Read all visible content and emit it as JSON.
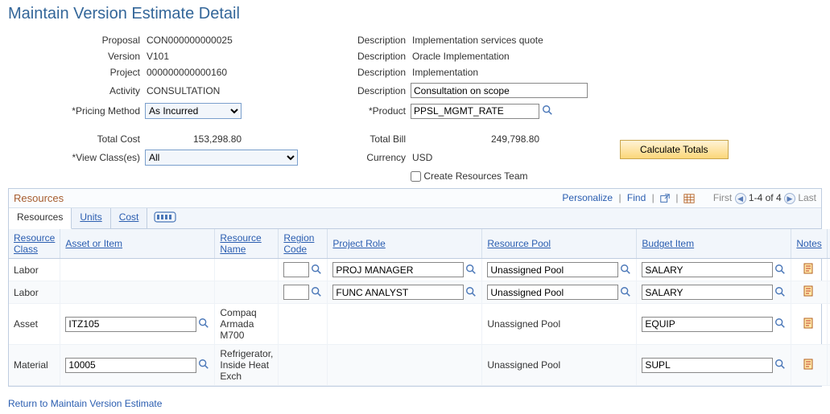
{
  "page_title": "Maintain Version Estimate Detail",
  "form": {
    "proposal": {
      "label": "Proposal",
      "value": "CON000000000025",
      "desc_label": "Description",
      "desc": "Implementation services quote"
    },
    "version": {
      "label": "Version",
      "value": "V101",
      "desc_label": "Description",
      "desc": "Oracle Implementation"
    },
    "project": {
      "label": "Project",
      "value": "000000000000160",
      "desc_label": "Description",
      "desc": "Implementation"
    },
    "activity": {
      "label": "Activity",
      "value": "CONSULTATION",
      "desc_label": "Description",
      "desc": "Consultation on scope"
    },
    "pricing_method": {
      "label": "*Pricing Method",
      "value": "As Incurred"
    },
    "product": {
      "label": "*Product",
      "value": "PPSL_MGMT_RATE"
    },
    "total_cost": {
      "label": "Total Cost",
      "value": "153,298.80"
    },
    "total_bill": {
      "label": "Total Bill",
      "value": "249,798.80"
    },
    "view_classes": {
      "label": "*View Class(es)",
      "value": "All"
    },
    "currency": {
      "label": "Currency",
      "value": "USD"
    },
    "create_team": {
      "label": "Create Resources Team"
    },
    "calc_button": "Calculate Totals"
  },
  "grid": {
    "title": "Resources",
    "links": {
      "personalize": "Personalize",
      "find": "Find"
    },
    "pager": {
      "first": "First",
      "range": "1-4 of 4",
      "last": "Last"
    },
    "tabs": {
      "resources": "Resources",
      "units": "Units",
      "cost": "Cost"
    },
    "headers": {
      "resource_class": "Resource Class",
      "asset_item": "Asset or Item",
      "resource_name": "Resource Name",
      "region_code": "Region Code",
      "project_role": "Project Role",
      "resource_pool": "Resource Pool",
      "budget_item": "Budget Item",
      "notes": "Notes"
    },
    "rows": [
      {
        "resource_class": "Labor",
        "asset_item": "",
        "resource_name": "",
        "region_code": "",
        "project_role": "PROJ MANAGER",
        "resource_pool": "Unassigned Pool",
        "budget_item": "SALARY"
      },
      {
        "resource_class": "Labor",
        "asset_item": "",
        "resource_name": "",
        "region_code": "",
        "project_role": "FUNC ANALYST",
        "resource_pool": "Unassigned Pool",
        "budget_item": "SALARY"
      },
      {
        "resource_class": "Asset",
        "asset_item": "ITZ105",
        "resource_name": "Compaq Armada M700",
        "region_code": "",
        "project_role": "",
        "resource_pool": "Unassigned Pool",
        "budget_item": "EQUIP"
      },
      {
        "resource_class": "Material",
        "asset_item": "10005",
        "resource_name": "Refrigerator, Inside Heat Exch",
        "region_code": "",
        "project_role": "",
        "resource_pool": "Unassigned Pool",
        "budget_item": "SUPL"
      }
    ]
  },
  "return_link": "Return to Maintain Version Estimate"
}
